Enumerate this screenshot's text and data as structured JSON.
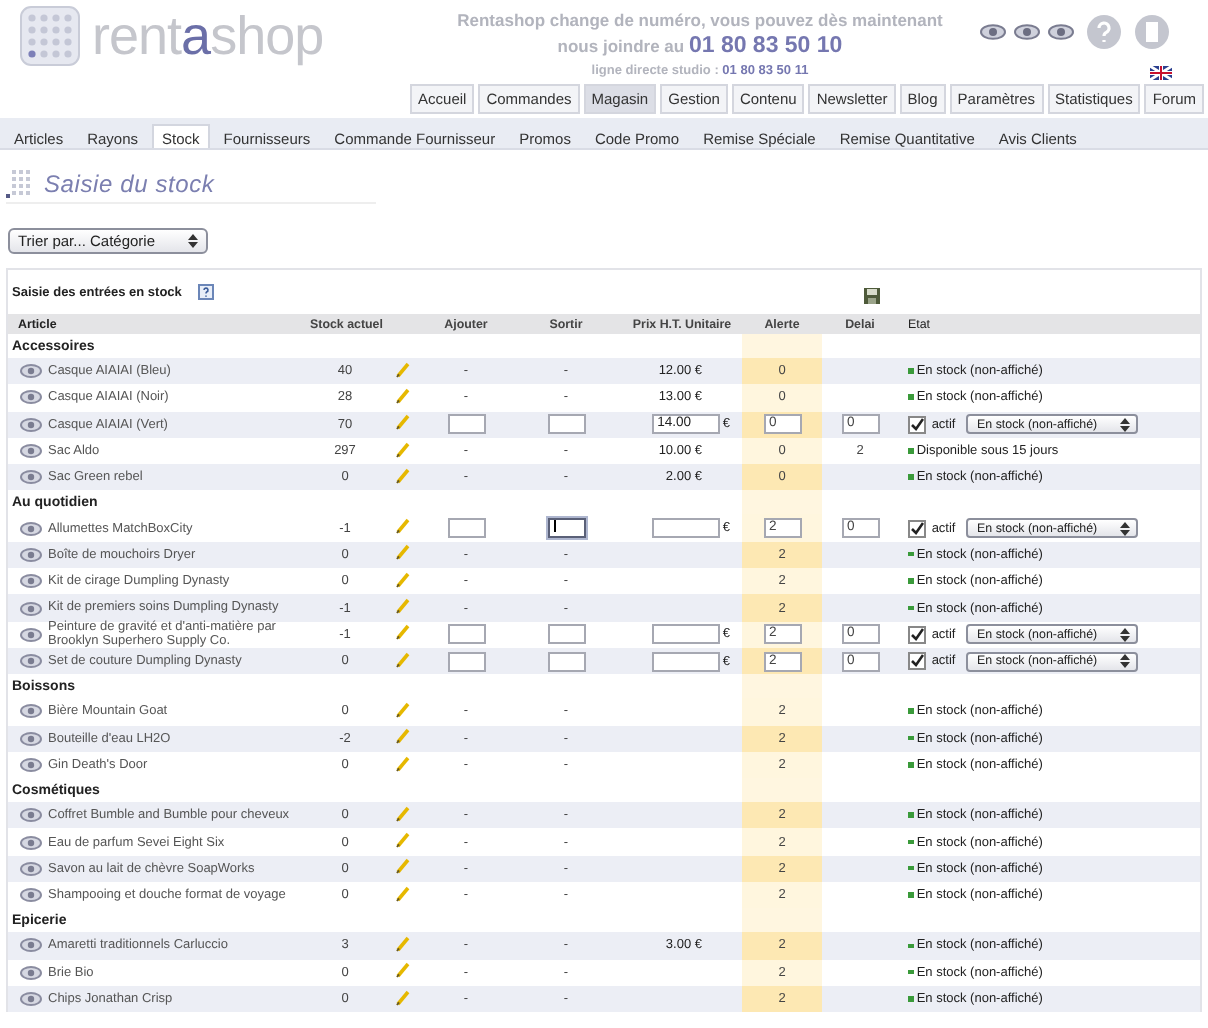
{
  "header": {
    "logo": {
      "before": "rent",
      "accent": "a",
      "after": "shop"
    },
    "notice": "Rentashop change de numéro, vous pouvez dès maintenant",
    "phone_lead": "nous joindre au",
    "phone": "01 80 83 50 10",
    "direct_label": "ligne directe studio :",
    "direct_phone": "01 80 83 50 11"
  },
  "main_nav": [
    {
      "label": "Accueil",
      "selected": false
    },
    {
      "label": "Commandes",
      "selected": false
    },
    {
      "label": "Magasin",
      "selected": true
    },
    {
      "label": "Gestion",
      "selected": false
    },
    {
      "label": "Contenu",
      "selected": false
    },
    {
      "label": "Newsletter",
      "selected": false
    },
    {
      "label": "Blog",
      "selected": false
    },
    {
      "label": "Paramètres",
      "selected": false
    },
    {
      "label": "Statistiques",
      "selected": false
    },
    {
      "label": "Forum",
      "selected": false
    }
  ],
  "sub_nav": [
    {
      "label": "Articles",
      "selected": false
    },
    {
      "label": "Rayons",
      "selected": false
    },
    {
      "label": "Stock",
      "selected": true
    },
    {
      "label": "Fournisseurs",
      "selected": false
    },
    {
      "label": "Commande Fournisseur",
      "selected": false
    },
    {
      "label": "Promos",
      "selected": false
    },
    {
      "label": "Code Promo",
      "selected": false
    },
    {
      "label": "Remise Spéciale",
      "selected": false
    },
    {
      "label": "Remise Quantitative",
      "selected": false
    },
    {
      "label": "Avis Clients",
      "selected": false
    }
  ],
  "page_title": "Saisie du stock",
  "sort_select": {
    "value": "Trier par... Catégorie"
  },
  "stock_panel": {
    "title": "Saisie des entrées en stock",
    "columns": [
      "Article",
      "Stock actuel",
      "Ajouter",
      "Sortir",
      "Prix H.T. Unitaire",
      "Alerte",
      "Delai",
      "Etat"
    ],
    "groups": [
      {
        "name": "Accessoires",
        "rows": [
          {
            "kind": "view",
            "article": "Casque AIAIAI (Bleu)",
            "stock": "40",
            "ajouter": "-",
            "sortir": "-",
            "prix": "12.00 €",
            "alerte": "0",
            "etat": "En stock (non-affiché)"
          },
          {
            "kind": "view",
            "article": "Casque AIAIAI (Noir)",
            "stock": "28",
            "ajouter": "-",
            "sortir": "-",
            "prix": "13.00 €",
            "alerte": "0",
            "etat": "En stock (non-affiché)"
          },
          {
            "kind": "edit",
            "article": "Casque AIAIAI (Vert)",
            "stock": "70",
            "prix": "14.00",
            "currency": "€",
            "alerte": "0",
            "delai": "0",
            "sortir_focused": false,
            "actif": true,
            "actif_label": "actif",
            "etat": "En stock (non-affiché)"
          },
          {
            "kind": "view",
            "article": "Sac Aldo",
            "stock": "297",
            "ajouter": "-",
            "sortir": "-",
            "prix": "10.00 €",
            "alerte": "0",
            "delai": "2",
            "etat": "Disponible sous 15 jours"
          },
          {
            "kind": "view",
            "article": "Sac Green rebel",
            "stock": "0",
            "ajouter": "-",
            "sortir": "-",
            "prix": "2.00 €",
            "alerte": "0",
            "etat": "En stock (non-affiché)"
          }
        ]
      },
      {
        "name": "Au quotidien",
        "rows": [
          {
            "kind": "edit",
            "article": "Allumettes MatchBoxCity",
            "stock": "-1",
            "currency": "€",
            "alerte": "2",
            "delai": "0",
            "sortir_focused": true,
            "actif": true,
            "actif_label": "actif",
            "etat": "En stock (non-affiché)"
          },
          {
            "kind": "view",
            "article": "Boîte de mouchoirs Dryer",
            "stock": "0",
            "ajouter": "-",
            "sortir": "-",
            "alerte": "2",
            "etat": "En stock (non-affiché)"
          },
          {
            "kind": "view",
            "article": "Kit de cirage Dumpling Dynasty",
            "stock": "0",
            "ajouter": "-",
            "sortir": "-",
            "alerte": "2",
            "etat": "En stock (non-affiché)"
          },
          {
            "kind": "view",
            "article": "Kit de premiers soins Dumpling Dynasty",
            "stock": "-1",
            "ajouter": "-",
            "sortir": "-",
            "alerte": "2",
            "etat": "En stock (non-affiché)"
          },
          {
            "kind": "edit",
            "article": "Peinture de gravité et d'anti-matière par Brooklyn Superhero Supply Co.",
            "stock": "-1",
            "currency": "€",
            "alerte": "2",
            "delai": "0",
            "sortir_focused": false,
            "actif": true,
            "actif_label": "actif",
            "etat": "En stock (non-affiché)"
          },
          {
            "kind": "edit",
            "article": "Set de couture Dumpling Dynasty",
            "stock": "0",
            "currency": "€",
            "alerte": "2",
            "delai": "0",
            "sortir_focused": false,
            "actif": true,
            "actif_label": "actif",
            "etat": "En stock (non-affiché)"
          }
        ]
      },
      {
        "name": "Boissons",
        "rows": [
          {
            "kind": "view",
            "article": "Bière Mountain Goat",
            "stock": "0",
            "ajouter": "-",
            "sortir": "-",
            "alerte": "2",
            "etat": "En stock (non-affiché)"
          },
          {
            "kind": "view",
            "article": "Bouteille d'eau LH2O",
            "stock": "-2",
            "ajouter": "-",
            "sortir": "-",
            "alerte": "2",
            "etat": "En stock (non-affiché)"
          },
          {
            "kind": "view",
            "article": "Gin Death's Door",
            "stock": "0",
            "ajouter": "-",
            "sortir": "-",
            "alerte": "2",
            "etat": "En stock (non-affiché)"
          }
        ]
      },
      {
        "name": "Cosmétiques",
        "rows": [
          {
            "kind": "view",
            "article": "Coffret Bumble and Bumble pour cheveux",
            "stock": "0",
            "ajouter": "-",
            "sortir": "-",
            "alerte": "2",
            "etat": "En stock (non-affiché)"
          },
          {
            "kind": "view",
            "article": "Eau de parfum Sevei Eight Six",
            "stock": "0",
            "ajouter": "-",
            "sortir": "-",
            "alerte": "2",
            "etat": "En stock (non-affiché)"
          },
          {
            "kind": "view",
            "article": "Savon au lait de chèvre SoapWorks",
            "stock": "0",
            "ajouter": "-",
            "sortir": "-",
            "alerte": "2",
            "etat": "En stock (non-affiché)"
          },
          {
            "kind": "view",
            "article": "Shampooing et douche format de voyage",
            "stock": "0",
            "ajouter": "-",
            "sortir": "-",
            "alerte": "2",
            "etat": "En stock (non-affiché)"
          }
        ]
      },
      {
        "name": "Epicerie",
        "rows": [
          {
            "kind": "view",
            "article": "Amaretti traditionnels Carluccio",
            "stock": "3",
            "ajouter": "-",
            "sortir": "-",
            "prix": "3.00 €",
            "alerte": "2",
            "etat": "En stock (non-affiché)"
          },
          {
            "kind": "view",
            "article": "Brie Bio",
            "stock": "0",
            "ajouter": "-",
            "sortir": "-",
            "alerte": "2",
            "etat": "En stock (non-affiché)"
          },
          {
            "kind": "view",
            "article": "Chips Jonathan Crisp",
            "stock": "0",
            "ajouter": "-",
            "sortir": "-",
            "alerte": "2",
            "etat": "En stock (non-affiché)"
          }
        ]
      }
    ]
  }
}
